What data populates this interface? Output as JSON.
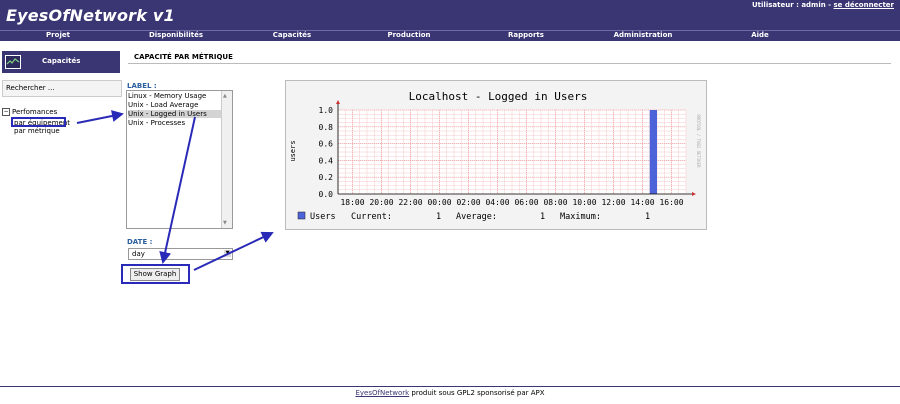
{
  "header": {
    "title": "EyesOfNetwork v1",
    "user_prefix": "Utilisateur : admin - ",
    "logout_label": "se déconnecter"
  },
  "nav": {
    "items": [
      "Projet",
      "Disponibilités",
      "Capacités",
      "Production",
      "Rapports",
      "Administration",
      "Aide"
    ]
  },
  "sidebar": {
    "section_label": "Capacités",
    "section_icon": "chart-icon",
    "search_label": "Rechercher ...",
    "tree_toggle": "−",
    "tree_root": "Perfomances",
    "tree_children": [
      "par équipement",
      "par métrique"
    ]
  },
  "main": {
    "page_title": "CAPACITÉ PAR MÉTRIQUE",
    "label_title": "LABEL :",
    "metrics": [
      "Linux - Memory Usage",
      "Unix - Load Average",
      "Unix - Logged in Users",
      "Unix - Processes"
    ],
    "selected_metric_index": 2,
    "date_title": "DATE :",
    "date_value": "day",
    "show_graph_label": "Show Graph"
  },
  "chart_data": {
    "type": "area",
    "title": "Localhost - Logged in Users",
    "ylabel": "users",
    "watermark": "RRDTOOL / TOBI OETIKER",
    "ylim": [
      0,
      1.0
    ],
    "y_ticks": [
      "0.0",
      "0.2",
      "0.4",
      "0.6",
      "0.8",
      "1.0"
    ],
    "x_ticks": [
      "18:00",
      "20:00",
      "22:00",
      "00:00",
      "02:00",
      "04:00",
      "06:00",
      "08:00",
      "10:00",
      "12:00",
      "14:00",
      "16:00"
    ],
    "series": [
      {
        "name": "Users",
        "color": "#4d63d9",
        "segments": [
          {
            "start": "14:30",
            "end": "15:00",
            "value": 1
          },
          {
            "start": "15:15",
            "end": "17:00",
            "value": 1
          }
        ]
      }
    ],
    "legend": {
      "current_label": "Current:",
      "current_value": "1",
      "average_label": "Average:",
      "average_value": "1",
      "maximum_label": "Maximum:",
      "maximum_value": "1"
    },
    "grid": true
  },
  "footer": {
    "link_label": "EyesOfNetwork",
    "text": " produit sous GPL2 sponsorisé par APX"
  },
  "colors": {
    "header_bg": "#3a3674",
    "accent_blue": "#2a5fa0",
    "annotation_blue": "#2a2ab8",
    "grid_red": "#f2b0b0"
  }
}
